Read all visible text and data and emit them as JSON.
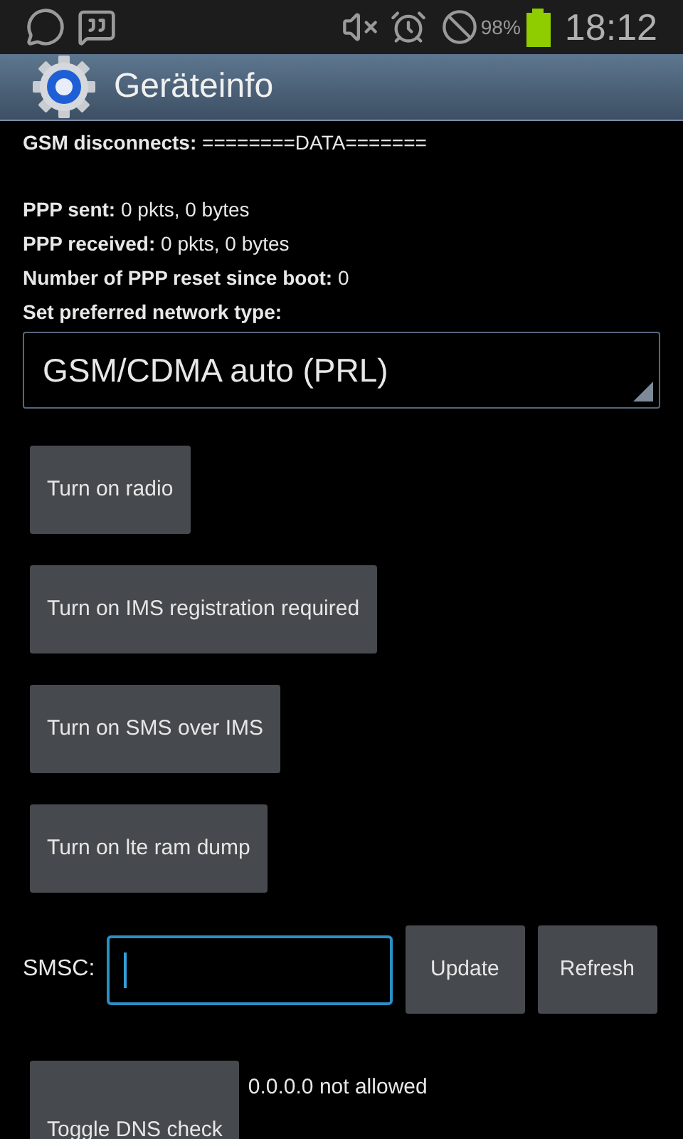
{
  "status_bar": {
    "battery_text": "98%",
    "time": "18:12"
  },
  "action_bar": {
    "title": "Geräteinfo"
  },
  "gsm_disconnects": "**GSM disconnects:** ========DATA=======",
  "info_lines": [
    "**PPP sent:** 0 pkts, 0 bytes",
    "**PPP received:** 0 pkts, 0 bytes",
    "**Number of PPP reset since boot:** 0",
    "**Set preferred network type:**"
  ],
  "network_type_spinner": {
    "value": "GSM/CDMA auto (PRL)"
  },
  "buttons": [
    "Turn on radio",
    "Turn on IMS registration required",
    "Turn on SMS over IMS",
    "Turn on lte ram dump"
  ],
  "smsc": {
    "label": "SMSC:",
    "buttons": [
      "Update",
      "Refresh"
    ]
  },
  "dns": {
    "button": "Toggle DNS check",
    "status": "0.0.0.0 not allowed"
  }
}
